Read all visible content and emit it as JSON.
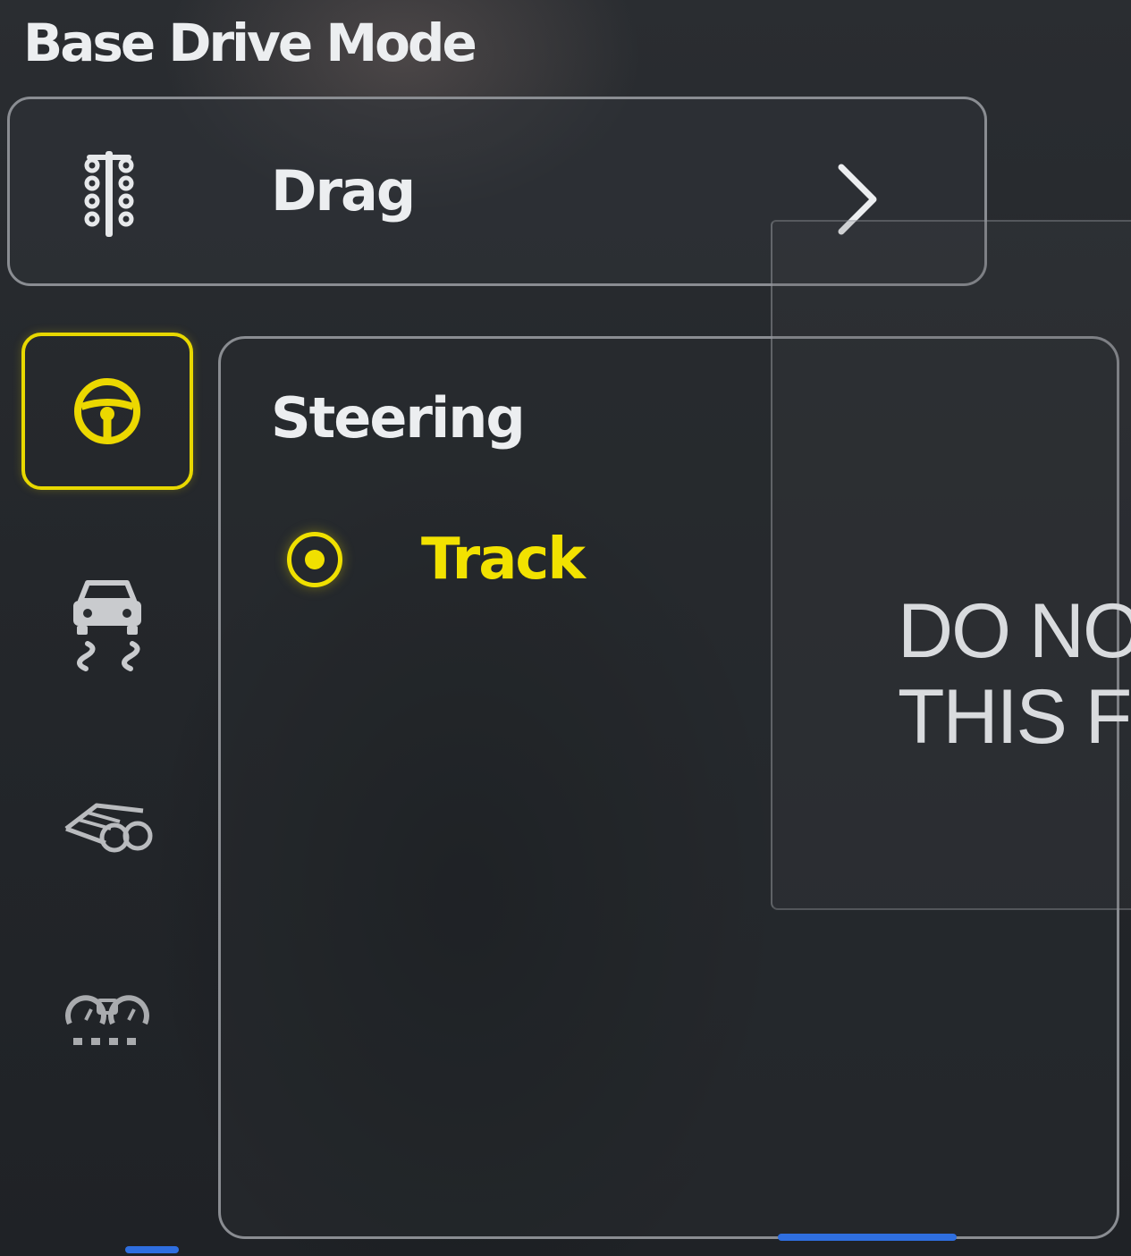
{
  "header": {
    "title": "Base Drive Mode"
  },
  "drive_mode": {
    "icon": "drag-tree-icon",
    "label": "Drag",
    "chevron_icon": "chevron-right-icon"
  },
  "side_nav": {
    "items": [
      {
        "icon": "steering-wheel-icon",
        "selected": true
      },
      {
        "icon": "traction-control-icon",
        "selected": false
      },
      {
        "icon": "exhaust-icon",
        "selected": false
      },
      {
        "icon": "gauges-icon",
        "selected": false
      }
    ]
  },
  "panel": {
    "heading": "Steering",
    "options": [
      {
        "label": "Track",
        "selected": true
      }
    ]
  },
  "film": {
    "line1": "DO NO",
    "line2": "THIS FI"
  },
  "colors": {
    "accent": "#f0e000",
    "border": "#8a8d92",
    "background": "#24272b",
    "text": "#eceef0"
  }
}
